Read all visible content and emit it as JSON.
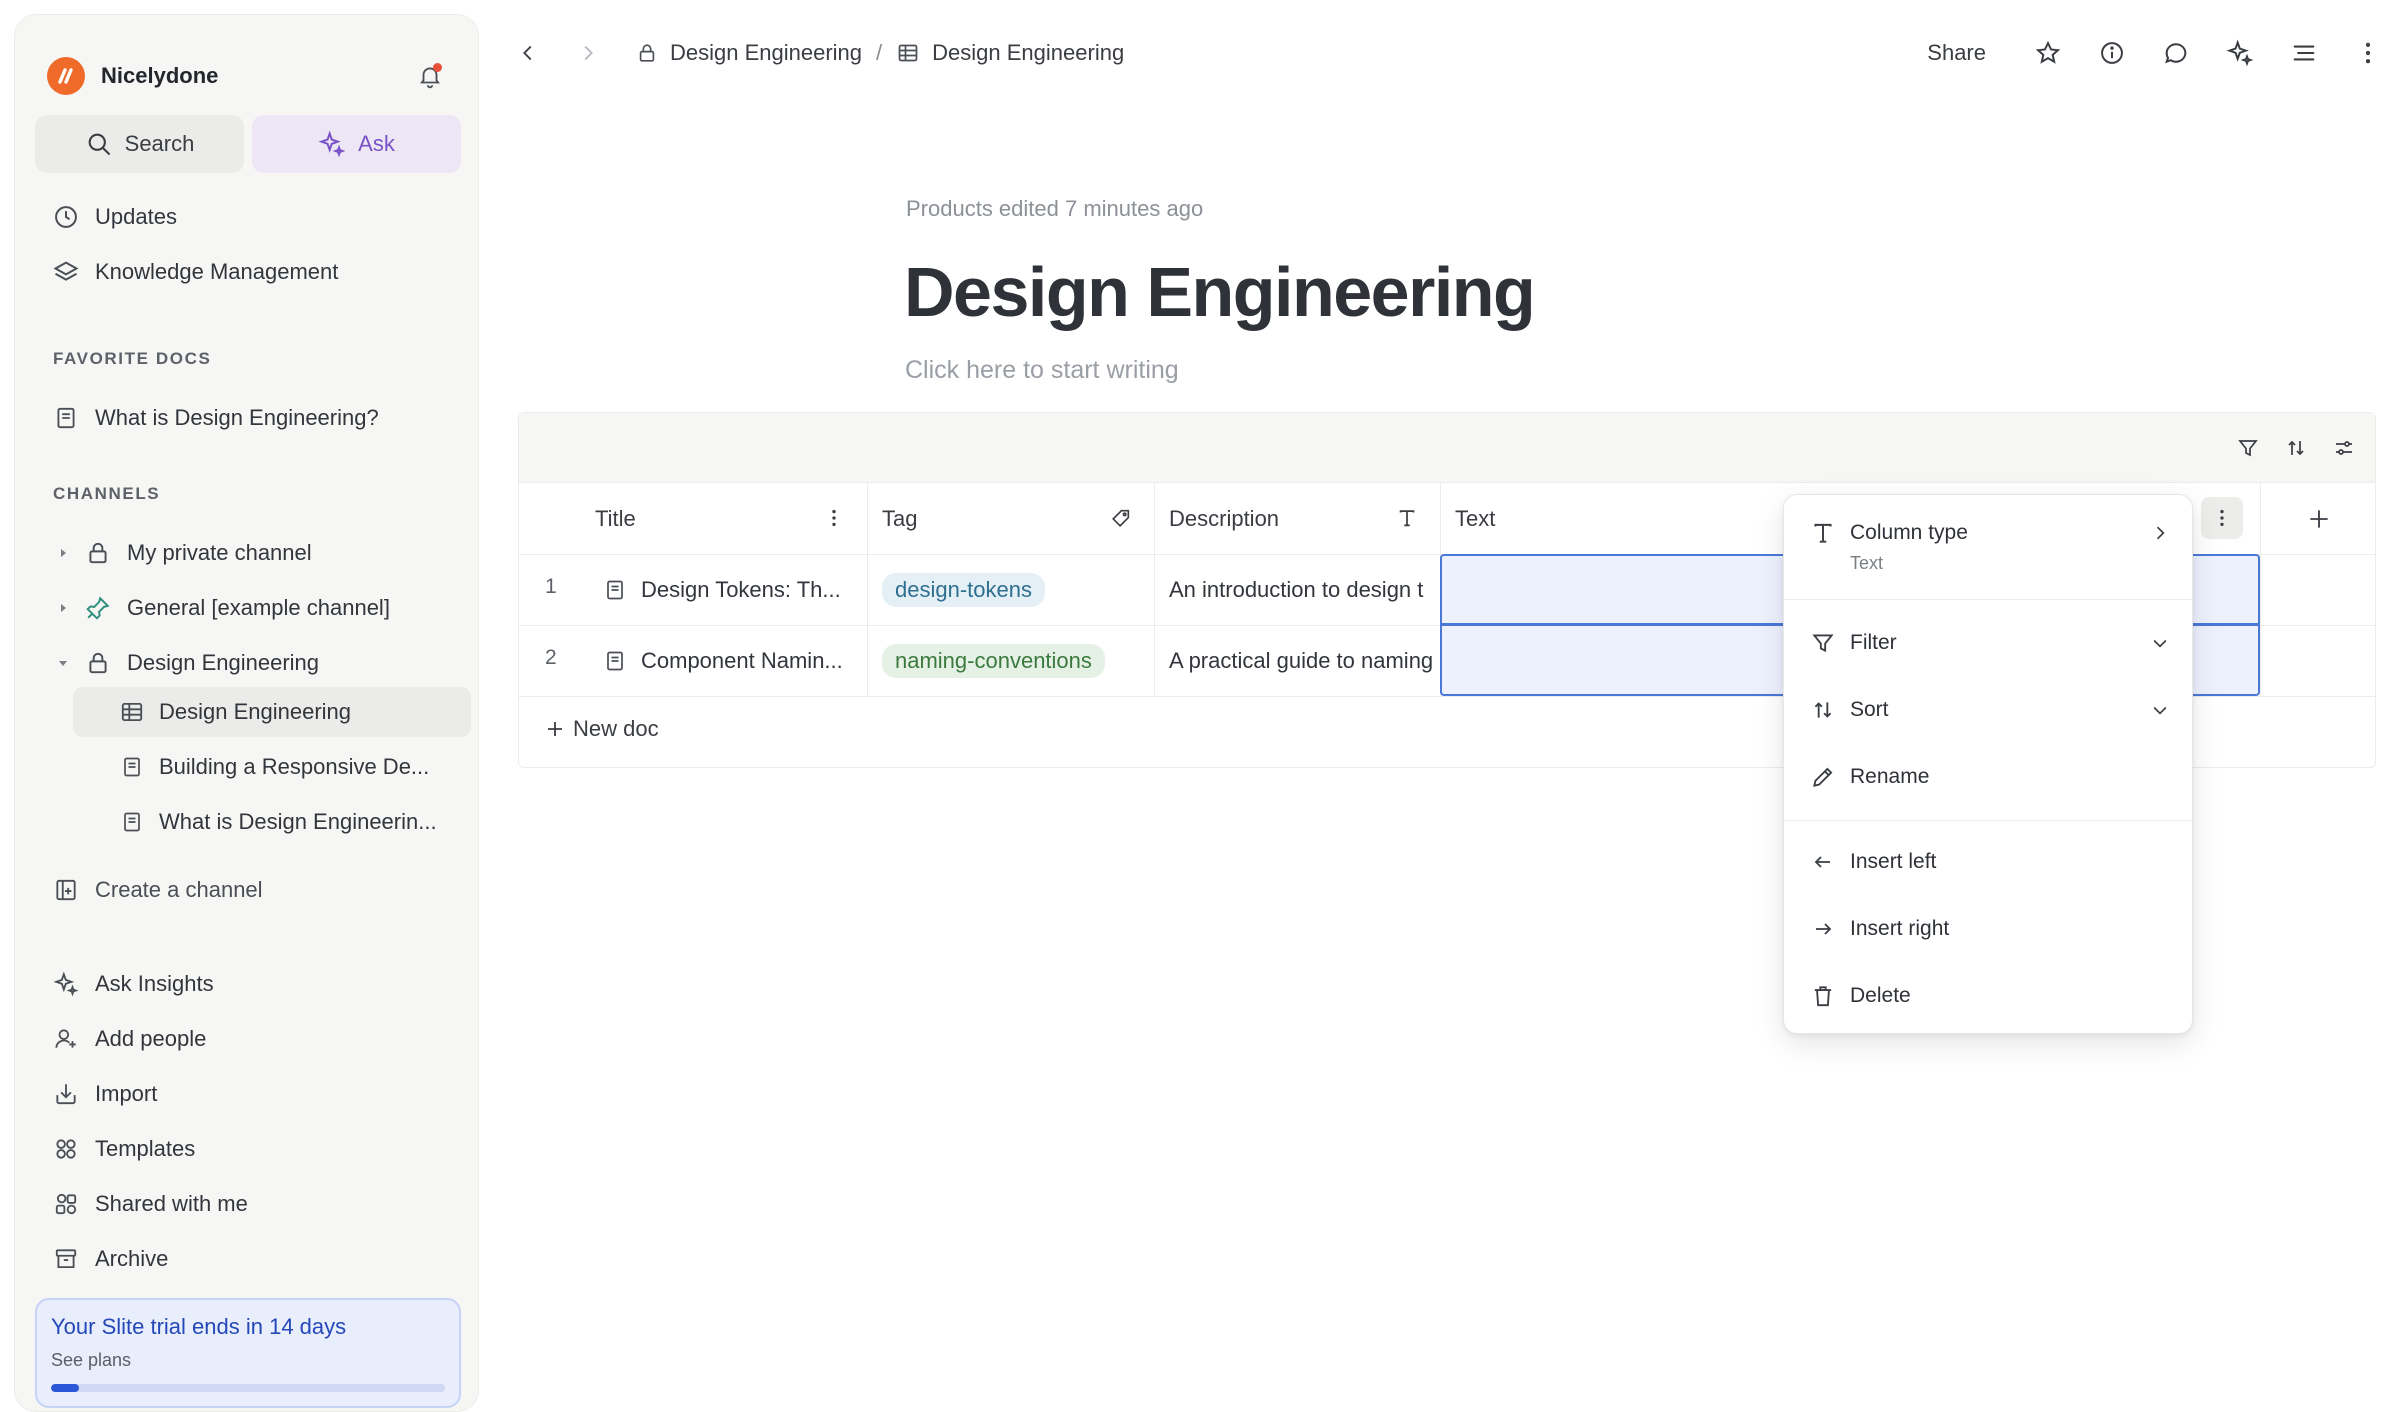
{
  "workspace": {
    "name": "Nicelydone"
  },
  "sidebar": {
    "search_label": "Search",
    "ask_label": "Ask",
    "nav": [
      {
        "label": "Updates",
        "icon": "clock-icon"
      },
      {
        "label": "Knowledge Management",
        "icon": "layers-icon"
      }
    ],
    "favorites_label": "FAVORITE DOCS",
    "favorites": [
      {
        "label": "What is Design Engineering?",
        "icon": "doc-icon"
      }
    ],
    "channels_label": "CHANNELS",
    "channels": [
      {
        "label": "My private channel",
        "icon": "lock-icon",
        "expanded": false
      },
      {
        "label": "General [example channel]",
        "icon": "pin-icon",
        "expanded": false
      },
      {
        "label": "Design Engineering",
        "icon": "lock-icon",
        "expanded": true
      }
    ],
    "channel_children": [
      {
        "label": "Design Engineering",
        "icon": "table-icon",
        "active": true
      },
      {
        "label": "Building a Responsive De...",
        "icon": "doc-icon",
        "active": false
      },
      {
        "label": "What is Design Engineerin...",
        "icon": "doc-icon",
        "active": false
      }
    ],
    "create_channel_label": "Create a channel",
    "bottom_nav": [
      {
        "label": "Ask Insights",
        "icon": "sparkle-icon"
      },
      {
        "label": "Add people",
        "icon": "add-person-icon"
      },
      {
        "label": "Import",
        "icon": "import-icon"
      },
      {
        "label": "Templates",
        "icon": "templates-icon"
      },
      {
        "label": "Shared with me",
        "icon": "shared-icon"
      },
      {
        "label": "Archive",
        "icon": "archive-icon"
      }
    ],
    "trial": {
      "title": "Your Slite trial ends in 14 days",
      "subtitle": "See plans",
      "progress": 0.07
    }
  },
  "topbar": {
    "breadcrumb": [
      {
        "label": "Design Engineering",
        "icon": "lock-icon"
      },
      {
        "label": "Design Engineering",
        "icon": "table-icon"
      }
    ],
    "separator": "/",
    "share_label": "Share"
  },
  "doc": {
    "meta": "Products edited 7 minutes ago",
    "title": "Design Engineering",
    "placeholder": "Click here to start writing"
  },
  "table": {
    "columns": [
      {
        "label": "Title",
        "icon": "more-vertical-icon"
      },
      {
        "label": "Tag",
        "icon": "tag-icon"
      },
      {
        "label": "Description",
        "icon": "text-type-icon"
      },
      {
        "label": "Text",
        "icon": "more-vertical-icon"
      }
    ],
    "rows": [
      {
        "num": "1",
        "title": "Design Tokens: Th...",
        "tag": "design-tokens",
        "description": "An introduction to design t"
      },
      {
        "num": "2",
        "title": "Component Namin...",
        "tag": "naming-conventions",
        "description": "A practical guide to naming"
      }
    ],
    "new_doc_label": "New doc",
    "add_column": "+"
  },
  "column_menu": {
    "column_type_label": "Column type",
    "column_type_value": "Text",
    "filter_label": "Filter",
    "sort_label": "Sort",
    "rename_label": "Rename",
    "insert_left_label": "Insert left",
    "insert_right_label": "Insert right",
    "delete_label": "Delete"
  },
  "colors": {
    "accent_orange": "#f06a2a",
    "ask_purple": "#7a52c7",
    "trial_blue": "#2448b8",
    "selection_blue": "#4a78d6"
  }
}
